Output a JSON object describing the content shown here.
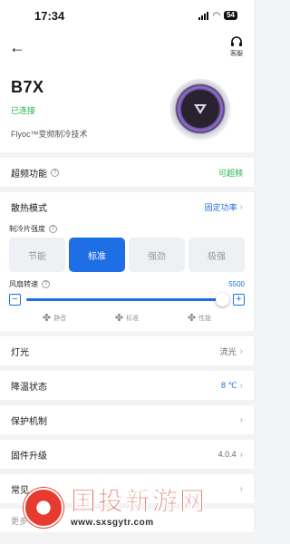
{
  "status_bar": {
    "time": "17:34",
    "battery": "54"
  },
  "header": {
    "back_icon": "arrow-left-icon",
    "service_label": "客服",
    "service_icon": "headset-icon"
  },
  "device": {
    "name": "B7X",
    "status": "已连接",
    "tech": "Flyoc™变频制冷技术",
    "status_color": "#22b44b"
  },
  "overclock": {
    "label": "超频功能",
    "value": "可超频"
  },
  "cooling_mode": {
    "label": "散热模式",
    "value": "固定功率"
  },
  "cooler_strength": {
    "label": "制冷片强度",
    "options": [
      "节能",
      "标准",
      "强劲",
      "极强"
    ],
    "selected": "标准"
  },
  "fan": {
    "label": "风扇转速",
    "value": "5500",
    "level": 1.0,
    "minus": "−",
    "plus": "+",
    "modes": [
      {
        "icon": "fan-quiet-icon",
        "label": "静音"
      },
      {
        "icon": "fan-standard-icon",
        "label": "标准"
      },
      {
        "icon": "fan-performance-icon",
        "label": "性能"
      }
    ]
  },
  "settings": {
    "light": {
      "label": "灯光",
      "value": "流光"
    },
    "cooling_state": {
      "label": "降温状态",
      "value": "8 ℃"
    },
    "protection": {
      "label": "保护机制"
    },
    "firmware": {
      "label": "固件升级",
      "value": "4.0.4"
    },
    "faq": {
      "label": "常见"
    },
    "more": {
      "label": "更多"
    }
  },
  "watermark": {
    "title": "国投新游网",
    "url": "www.sxsgytr.com"
  },
  "colors": {
    "accent": "#1e6ee6",
    "green": "#22b44b",
    "watermark_red": "#c8331f"
  }
}
